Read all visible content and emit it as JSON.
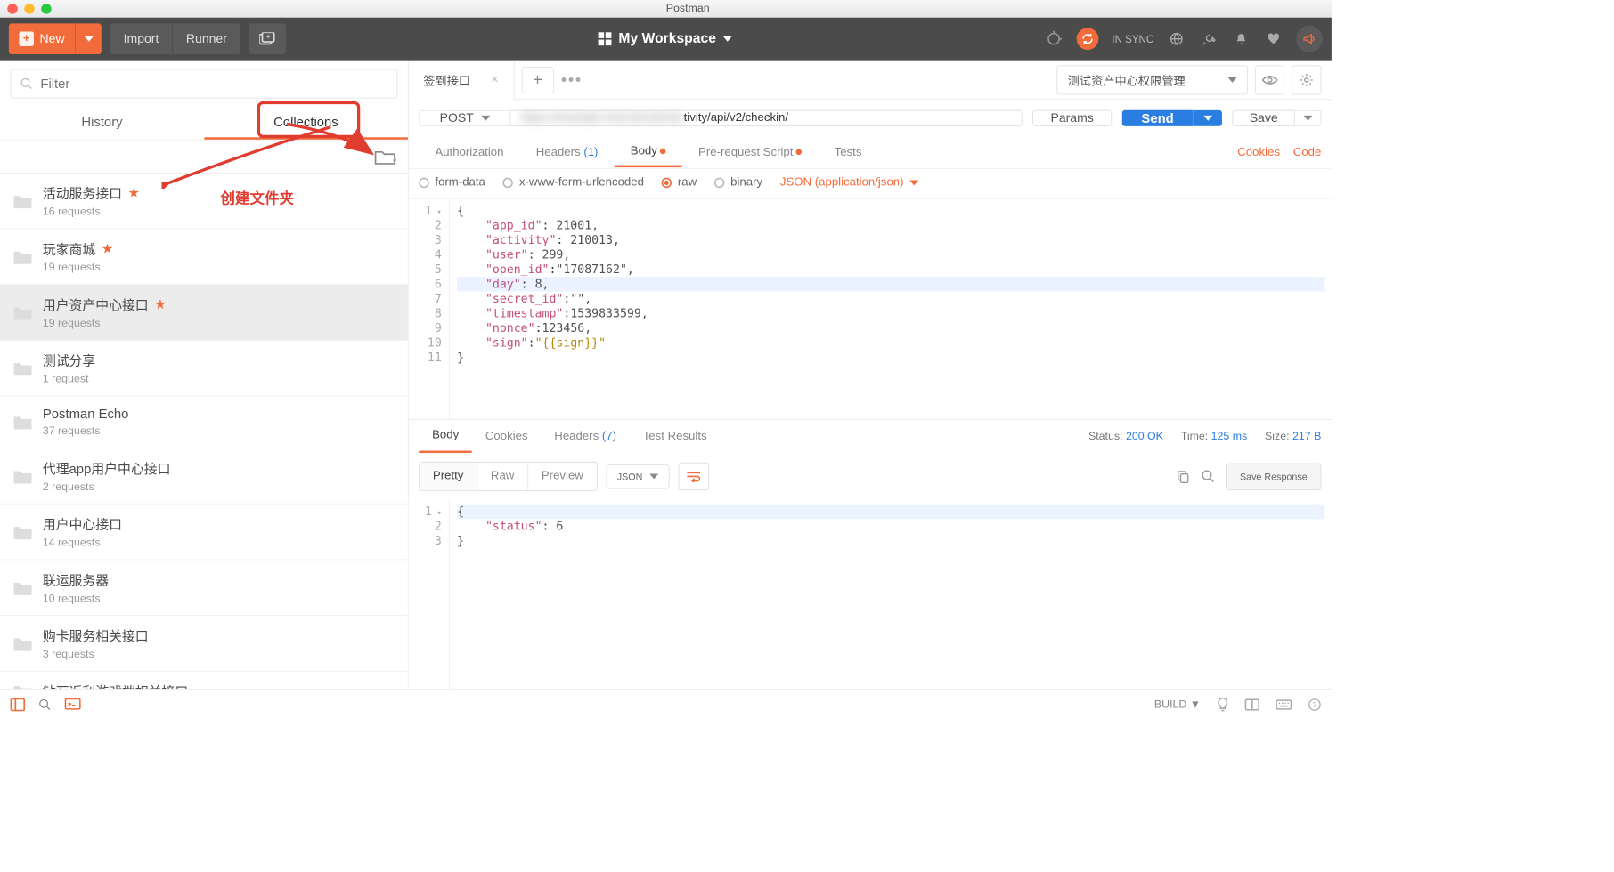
{
  "window": {
    "title": "Postman"
  },
  "topbar": {
    "new": "New",
    "import": "Import",
    "runner": "Runner",
    "workspace": "My Workspace",
    "sync": "IN SYNC"
  },
  "sidebar": {
    "filter_placeholder": "Filter",
    "tabs": {
      "history": "History",
      "collections": "Collections"
    },
    "annotation": "创建文件夹",
    "items": [
      {
        "name": "活动服务接口",
        "count": "16 requests",
        "star": true
      },
      {
        "name": "玩家商城",
        "count": "19 requests",
        "star": true
      },
      {
        "name": "用户资产中心接口",
        "count": "19 requests",
        "star": true,
        "selected": true
      },
      {
        "name": "测试分享",
        "count": "1 request",
        "star": false
      },
      {
        "name": "Postman Echo",
        "count": "37 requests",
        "star": false
      },
      {
        "name": "代理app用户中心接口",
        "count": "2 requests",
        "star": false
      },
      {
        "name": "用户中心接口",
        "count": "14 requests",
        "star": false
      },
      {
        "name": "联运服务器",
        "count": "10 requests",
        "star": false
      },
      {
        "name": "购卡服务相关接口",
        "count": "3 requests",
        "star": false
      },
      {
        "name": "钻石返利游戏端相关接口",
        "count": "",
        "star": false
      }
    ]
  },
  "tabs": {
    "active": "签到接口",
    "env": "测试资产中心权限管理"
  },
  "request": {
    "method": "POST",
    "url_tail": "tivity/api/v2/checkin/",
    "params": "Params",
    "send": "Send",
    "save": "Save",
    "subtabs": {
      "auth": "Authorization",
      "headers": "Headers",
      "headers_n": "(1)",
      "body": "Body",
      "prereq": "Pre-request Script",
      "tests": "Tests"
    },
    "right_links": {
      "cookies": "Cookies",
      "code": "Code"
    },
    "body_opts": {
      "formdata": "form-data",
      "urlenc": "x-www-form-urlencoded",
      "raw": "raw",
      "binary": "binary",
      "ctype": "JSON (application/json)"
    },
    "body_json": {
      "lines": [
        "{",
        "    \"app_id\": 21001,",
        "    \"activity\": 210013,",
        "    \"user\": 299,",
        "    \"open_id\":\"17087162\",",
        "    \"day\": 8,",
        "    \"secret_id\":\"\",",
        "    \"timestamp\":1539833599,",
        "    \"nonce\":123456,",
        "    \"sign\":\"{{sign}}\"",
        "}"
      ]
    }
  },
  "response": {
    "tabs": {
      "body": "Body",
      "cookies": "Cookies",
      "headers": "Headers",
      "headers_n": "(7)",
      "tests": "Test Results"
    },
    "status_label": "Status:",
    "status": "200 OK",
    "time_label": "Time:",
    "time": "125 ms",
    "size_label": "Size:",
    "size": "217 B",
    "views": {
      "pretty": "Pretty",
      "raw": "Raw",
      "preview": "Preview"
    },
    "lang": "JSON",
    "save": "Save Response",
    "body_lines": [
      "{",
      "    \"status\": 6",
      "}"
    ]
  },
  "bottom": {
    "build": "BUILD"
  }
}
